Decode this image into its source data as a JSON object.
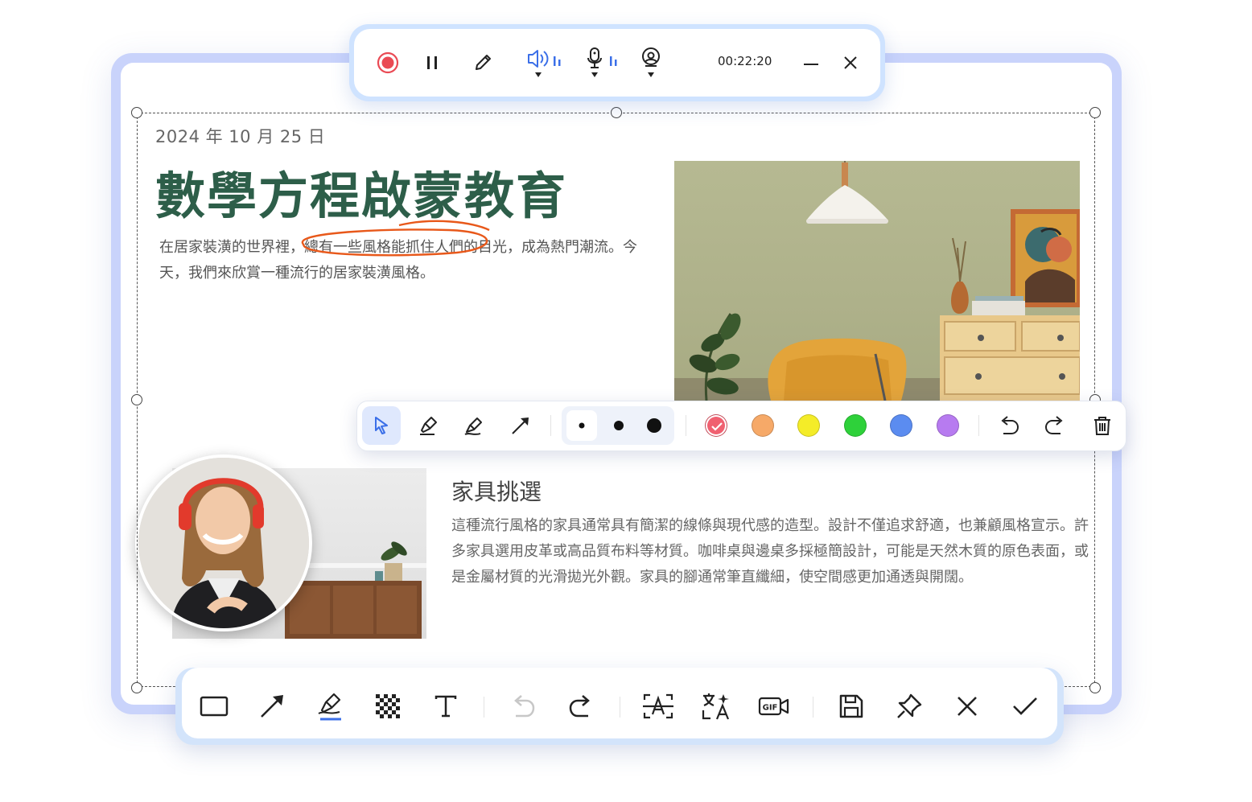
{
  "document": {
    "date": "2024 年 10 月 25 日",
    "title": "數學方程啟蒙教育",
    "intro_before": "在居家裝潢的世界裡，",
    "intro_highlight": "總有一些風格能抓住人們的",
    "intro_after": "目光，成為熱門潮流。今天，我們來欣賞一種流行的居家裝潢風格。",
    "section_heading": "家具挑選",
    "section_body": "這種流行風格的家具通常具有簡潔的線條與現代感的造型。設計不僅追求舒適，也兼顧風格宣示。許多家具選用皮革或高品質布料等材質。咖啡桌與邊桌多採極簡設計，可能是天然木質的原色表面，或是金屬材質的光滑拋光外觀。家具的腳通常筆直纖細，使空間感更加通透與開闊。"
  },
  "recording_toolbar": {
    "timer": "00:22:20",
    "icons": [
      "record-stop-icon",
      "pause-icon",
      "pen-icon",
      "speaker-icon",
      "microphone-icon",
      "webcam-icon",
      "minimize-icon",
      "close-icon"
    ]
  },
  "drawing_toolbar": {
    "tools": [
      "cursor-icon",
      "highlighter-icon",
      "marker-icon",
      "arrow-icon"
    ],
    "brush_sizes": [
      "small",
      "medium",
      "large"
    ],
    "selected_size": "small",
    "colors": [
      "#f06070",
      "#f6a968",
      "#f4ec28",
      "#2ed13a",
      "#5b8cf0",
      "#b77bf0"
    ],
    "selected_color": "#f06070",
    "actions": [
      "undo-icon",
      "redo-icon",
      "trash-icon"
    ]
  },
  "bottom_toolbar": {
    "tools": [
      "rectangle-icon",
      "arrow-icon",
      "highlighter-icon",
      "mosaic-icon",
      "text-icon",
      "undo-icon",
      "redo-icon",
      "ocr-icon",
      "translate-icon",
      "gif-icon",
      "save-icon",
      "pin-icon",
      "cancel-icon",
      "confirm-icon"
    ],
    "gif_label": "GIF",
    "accent": "#3b6fe8"
  }
}
